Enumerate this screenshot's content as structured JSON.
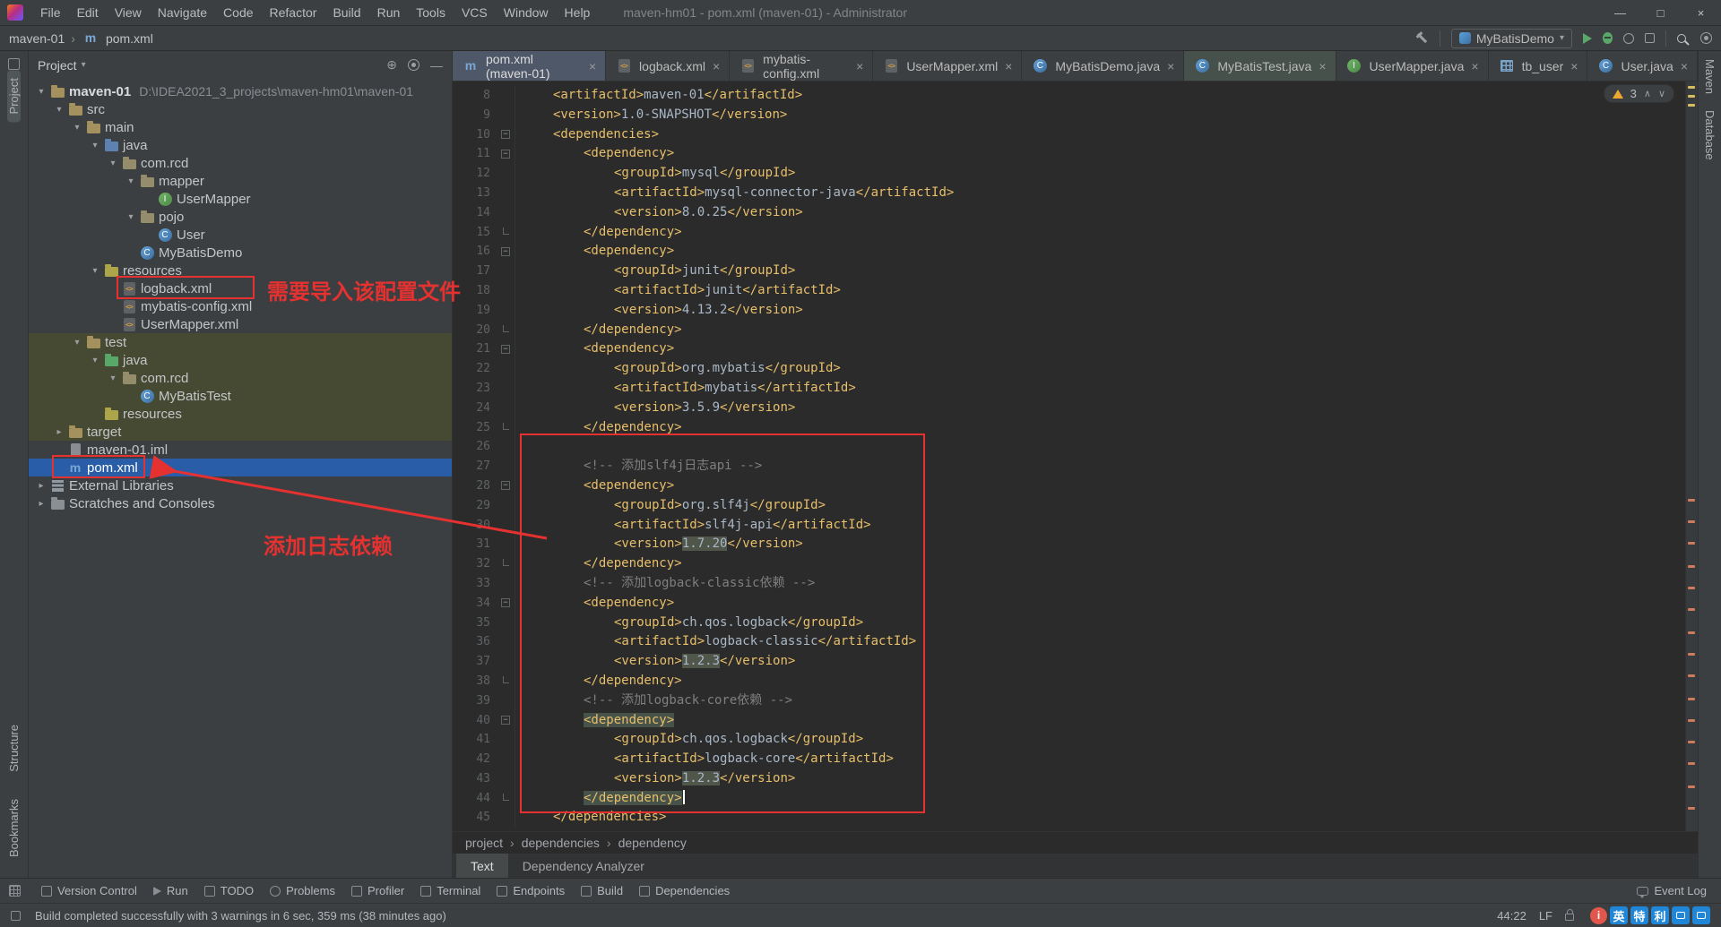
{
  "window": {
    "title": "maven-hm01 - pom.xml (maven-01) - Administrator",
    "menus": [
      "File",
      "Edit",
      "View",
      "Navigate",
      "Code",
      "Refactor",
      "Build",
      "Run",
      "Tools",
      "VCS",
      "Window",
      "Help"
    ],
    "controls": {
      "minimize": "—",
      "maximize": "□",
      "close": "×"
    }
  },
  "glyphs": {
    "expanded": "▾",
    "collapsed": "▸",
    "close": "×",
    "separator": "›",
    "dropdown": "▾",
    "up": "∧",
    "down": "∨"
  },
  "navbar": {
    "crumb_project": "maven-01",
    "crumb_file": "pom.xml",
    "run_config": "MyBatisDemo"
  },
  "stripes": {
    "left_top": "Project",
    "left_bottom": [
      "Structure",
      "Bookmarks"
    ],
    "right": [
      "Maven",
      "Database"
    ]
  },
  "project_panel": {
    "title": "Project",
    "tree": [
      {
        "label": "maven-01",
        "hint": "D:\\IDEA2021_3_projects\\maven-hm01\\maven-01",
        "level": 0,
        "icon": "folder",
        "arrow": "open",
        "bold": true
      },
      {
        "label": "src",
        "level": 1,
        "icon": "folder",
        "arrow": "open"
      },
      {
        "label": "main",
        "level": 2,
        "icon": "folder",
        "arrow": "open"
      },
      {
        "label": "java",
        "level": 3,
        "icon": "srcroot",
        "arrow": "open"
      },
      {
        "label": "com.rcd",
        "level": 4,
        "icon": "pkg",
        "arrow": "open"
      },
      {
        "label": "mapper",
        "level": 5,
        "icon": "pkg",
        "arrow": "open"
      },
      {
        "label": "UserMapper",
        "level": 6,
        "icon": "iface"
      },
      {
        "label": "pojo",
        "level": 5,
        "icon": "pkg",
        "arrow": "open"
      },
      {
        "label": "User",
        "level": 6,
        "icon": "class"
      },
      {
        "label": "MyBatisDemo",
        "level": 5,
        "icon": "class"
      },
      {
        "label": "resources",
        "level": 3,
        "icon": "resroot",
        "arrow": "open"
      },
      {
        "label": "logback.xml",
        "level": 4,
        "icon": "xml"
      },
      {
        "label": "mybatis-config.xml",
        "level": 4,
        "icon": "xml"
      },
      {
        "label": "UserMapper.xml",
        "level": 4,
        "icon": "xml"
      },
      {
        "label": "test",
        "level": 2,
        "icon": "folder",
        "arrow": "open",
        "tint": true
      },
      {
        "label": "java",
        "level": 3,
        "icon": "testroot",
        "arrow": "open",
        "tint": true
      },
      {
        "label": "com.rcd",
        "level": 4,
        "icon": "pkg",
        "arrow": "open",
        "tint": true
      },
      {
        "label": "MyBatisTest",
        "level": 5,
        "icon": "class",
        "tint": true
      },
      {
        "label": "resources",
        "level": 3,
        "icon": "resroot",
        "tint": true
      },
      {
        "label": "target",
        "level": 1,
        "icon": "folder",
        "arrow": "closed",
        "tint": true
      },
      {
        "label": "maven-01.iml",
        "level": 1,
        "icon": "iml"
      },
      {
        "label": "pom.xml",
        "level": 1,
        "icon": "maven",
        "sel": true
      },
      {
        "label": "External Libraries",
        "level": 0,
        "icon": "lib",
        "arrow": "closed"
      },
      {
        "label": "Scratches and Consoles",
        "level": 0,
        "icon": "scratch",
        "arrow": "closed"
      }
    ]
  },
  "editor": {
    "tabs": [
      {
        "label": "pom.xml (maven-01)",
        "icon": "maven",
        "active": true
      },
      {
        "label": "logback.xml",
        "icon": "xml"
      },
      {
        "label": "mybatis-config.xml",
        "icon": "xml"
      },
      {
        "label": "UserMapper.xml",
        "icon": "xml"
      },
      {
        "label": "MyBatisDemo.java",
        "icon": "class"
      },
      {
        "label": "MyBatisTest.java",
        "icon": "class",
        "test": true
      },
      {
        "label": "UserMapper.java",
        "icon": "iface"
      },
      {
        "label": "tb_user",
        "icon": "table"
      },
      {
        "label": "User.java",
        "icon": "class"
      }
    ],
    "inspection": {
      "warnings": "3"
    },
    "breadcrumbs": [
      "project",
      "dependencies",
      "dependency"
    ],
    "view_tabs": [
      {
        "label": "Text",
        "active": true
      },
      {
        "label": "Dependency Analyzer",
        "active": false
      }
    ],
    "code": {
      "lines": [
        {
          "n": 8,
          "i": 1,
          "s": [
            [
              "t",
              "<artifactId>"
            ],
            [
              "x",
              "maven-01"
            ],
            [
              "t",
              "</artifactId>"
            ]
          ]
        },
        {
          "n": 9,
          "i": 1,
          "s": [
            [
              "t",
              "<version>"
            ],
            [
              "x",
              "1.0-SNAPSHOT"
            ],
            [
              "t",
              "</version>"
            ]
          ]
        },
        {
          "n": 10,
          "i": 1,
          "f": "o",
          "s": [
            [
              "t",
              "<dependencies>"
            ]
          ]
        },
        {
          "n": 11,
          "i": 2,
          "f": "o",
          "s": [
            [
              "t",
              "<dependency>"
            ]
          ]
        },
        {
          "n": 12,
          "i": 3,
          "s": [
            [
              "t",
              "<groupId>"
            ],
            [
              "x",
              "mysql"
            ],
            [
              "t",
              "</groupId>"
            ]
          ]
        },
        {
          "n": 13,
          "i": 3,
          "s": [
            [
              "t",
              "<artifactId>"
            ],
            [
              "x",
              "mysql-connector-java"
            ],
            [
              "t",
              "</artifactId>"
            ]
          ]
        },
        {
          "n": 14,
          "i": 3,
          "s": [
            [
              "t",
              "<version>"
            ],
            [
              "x",
              "8.0.25"
            ],
            [
              "t",
              "</version>"
            ]
          ]
        },
        {
          "n": 15,
          "i": 2,
          "f": "e",
          "s": [
            [
              "t",
              "</dependency>"
            ]
          ]
        },
        {
          "n": 16,
          "i": 2,
          "f": "o",
          "s": [
            [
              "t",
              "<dependency>"
            ]
          ]
        },
        {
          "n": 17,
          "i": 3,
          "s": [
            [
              "t",
              "<groupId>"
            ],
            [
              "x",
              "junit"
            ],
            [
              "t",
              "</groupId>"
            ]
          ]
        },
        {
          "n": 18,
          "i": 3,
          "s": [
            [
              "t",
              "<artifactId>"
            ],
            [
              "x",
              "junit"
            ],
            [
              "t",
              "</artifactId>"
            ]
          ]
        },
        {
          "n": 19,
          "i": 3,
          "s": [
            [
              "t",
              "<version>"
            ],
            [
              "x",
              "4.13.2"
            ],
            [
              "t",
              "</version>"
            ]
          ]
        },
        {
          "n": 20,
          "i": 2,
          "f": "e",
          "s": [
            [
              "t",
              "</dependency>"
            ]
          ]
        },
        {
          "n": 21,
          "i": 2,
          "f": "o",
          "s": [
            [
              "t",
              "<dependency>"
            ]
          ]
        },
        {
          "n": 22,
          "i": 3,
          "s": [
            [
              "t",
              "<groupId>"
            ],
            [
              "x",
              "org.mybatis"
            ],
            [
              "t",
              "</groupId>"
            ]
          ]
        },
        {
          "n": 23,
          "i": 3,
          "s": [
            [
              "t",
              "<artifactId>"
            ],
            [
              "x",
              "mybatis"
            ],
            [
              "t",
              "</artifactId>"
            ]
          ]
        },
        {
          "n": 24,
          "i": 3,
          "s": [
            [
              "t",
              "<version>"
            ],
            [
              "x",
              "3.5.9"
            ],
            [
              "t",
              "</version>"
            ]
          ]
        },
        {
          "n": 25,
          "i": 2,
          "f": "e",
          "s": [
            [
              "t",
              "</dependency>"
            ]
          ]
        },
        {
          "n": 26,
          "i": 0,
          "s": []
        },
        {
          "n": 27,
          "i": 2,
          "s": [
            [
              "c",
              "<!-- 添加slf4j日志api -->"
            ]
          ]
        },
        {
          "n": 28,
          "i": 2,
          "f": "o",
          "s": [
            [
              "t",
              "<dependency>"
            ]
          ]
        },
        {
          "n": 29,
          "i": 3,
          "s": [
            [
              "t",
              "<groupId>"
            ],
            [
              "x",
              "org.slf4j"
            ],
            [
              "t",
              "</groupId>"
            ]
          ]
        },
        {
          "n": 30,
          "i": 3,
          "s": [
            [
              "t",
              "<artifactId>"
            ],
            [
              "x",
              "slf4j-api"
            ],
            [
              "t",
              "</artifactId>"
            ]
          ]
        },
        {
          "n": 31,
          "i": 3,
          "s": [
            [
              "t",
              "<version>"
            ],
            [
              "hv",
              "1.7.20"
            ],
            [
              "t",
              "</version>"
            ]
          ]
        },
        {
          "n": 32,
          "i": 2,
          "f": "e",
          "s": [
            [
              "t",
              "</dependency>"
            ]
          ]
        },
        {
          "n": 33,
          "i": 2,
          "s": [
            [
              "c",
              "<!-- 添加logback-classic依赖 -->"
            ]
          ]
        },
        {
          "n": 34,
          "i": 2,
          "f": "o",
          "s": [
            [
              "t",
              "<dependency>"
            ]
          ]
        },
        {
          "n": 35,
          "i": 3,
          "s": [
            [
              "t",
              "<groupId>"
            ],
            [
              "x",
              "ch.qos.logback"
            ],
            [
              "t",
              "</groupId>"
            ]
          ]
        },
        {
          "n": 36,
          "i": 3,
          "s": [
            [
              "t",
              "<artifactId>"
            ],
            [
              "x",
              "logback-classic"
            ],
            [
              "t",
              "</artifactId>"
            ]
          ]
        },
        {
          "n": 37,
          "i": 3,
          "s": [
            [
              "t",
              "<version>"
            ],
            [
              "hv",
              "1.2.3"
            ],
            [
              "t",
              "</version>"
            ]
          ]
        },
        {
          "n": 38,
          "i": 2,
          "f": "e",
          "s": [
            [
              "t",
              "</dependency>"
            ]
          ]
        },
        {
          "n": 39,
          "i": 2,
          "s": [
            [
              "c",
              "<!-- 添加logback-core依赖 -->"
            ]
          ]
        },
        {
          "n": 40,
          "i": 2,
          "f": "o",
          "s": [
            [
              "ht",
              "<dependency>"
            ]
          ]
        },
        {
          "n": 41,
          "i": 3,
          "s": [
            [
              "t",
              "<groupId>"
            ],
            [
              "x",
              "ch.qos.logback"
            ],
            [
              "t",
              "</groupId>"
            ]
          ]
        },
        {
          "n": 42,
          "i": 3,
          "s": [
            [
              "t",
              "<artifactId>"
            ],
            [
              "x",
              "logback-core"
            ],
            [
              "t",
              "</artifactId>"
            ]
          ]
        },
        {
          "n": 43,
          "i": 3,
          "s": [
            [
              "t",
              "<version>"
            ],
            [
              "hv",
              "1.2.3"
            ],
            [
              "t",
              "</version>"
            ]
          ]
        },
        {
          "n": 44,
          "i": 2,
          "f": "e",
          "s": [
            [
              "ht",
              "</dependency>"
            ],
            [
              "caret",
              ""
            ]
          ]
        },
        {
          "n": 45,
          "i": 1,
          "s": [
            [
              "t",
              "</dependencies>"
            ]
          ]
        }
      ]
    },
    "error_stripe": {
      "yellow": [
        5,
        15,
        25
      ],
      "orange": [
        466,
        490,
        514,
        540,
        564,
        588,
        614,
        638,
        662,
        688,
        712,
        736,
        760,
        786,
        810
      ]
    }
  },
  "annotations": {
    "note_config": "需要导入该配置文件",
    "note_dependency": "添加日志依赖",
    "color": "#e53130"
  },
  "bottom_bar": {
    "items": [
      {
        "label": "Version Control",
        "icon": "branch"
      },
      {
        "label": "Run",
        "icon": "run"
      },
      {
        "label": "TODO",
        "icon": "todo"
      },
      {
        "label": "Problems",
        "icon": "problems"
      },
      {
        "label": "Profiler",
        "icon": "profiler"
      },
      {
        "label": "Terminal",
        "icon": "terminal"
      },
      {
        "label": "Endpoints",
        "icon": "endpoints"
      },
      {
        "label": "Build",
        "icon": "build"
      },
      {
        "label": "Dependencies",
        "icon": "dependencies"
      }
    ],
    "event_log": "Event Log"
  },
  "status_bar": {
    "message": "Build completed successfully with 3 warnings in 6 sec, 359 ms (38 minutes ago)",
    "caret_position": "44:22",
    "line_separator": "LF",
    "watermark": {
      "circle": "i",
      "chars": [
        "英",
        "特",
        "利"
      ]
    }
  }
}
